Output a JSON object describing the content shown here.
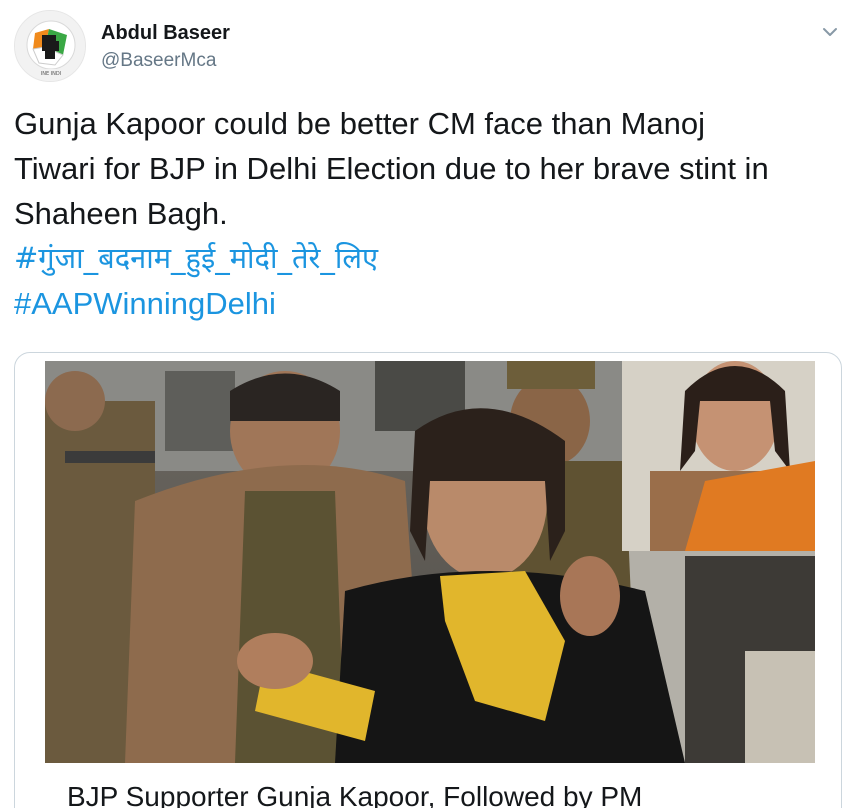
{
  "user": {
    "display_name": "Abdul Baseer",
    "handle": "@BaseerMca"
  },
  "icons": {
    "menu": "chevron-down-icon",
    "avatar": "raised-fist-logo"
  },
  "tweet": {
    "text_lines": [
      "Gunja Kapoor could be better CM face than Manoj",
      "Tiwari for BJP in Delhi Election due to her brave stint in",
      "Shaheen Bagh."
    ],
    "hashtags": [
      "#गुंजा_बदनाम_हुई_मोदी_तेरे_लिए",
      "#AAPWinningDelhi"
    ]
  },
  "card": {
    "title": "BJP Supporter Gunja Kapoor, Followed by PM"
  },
  "colors": {
    "link": "#1b95e0",
    "secondary_text": "#657786",
    "border": "#ccd6dd"
  }
}
